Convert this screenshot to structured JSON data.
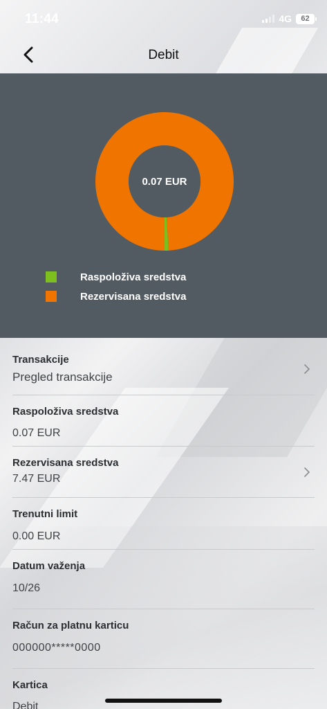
{
  "status_bar": {
    "time": "11:44",
    "network": "4G",
    "battery": "62"
  },
  "header": {
    "title": "Debit"
  },
  "chart_data": {
    "type": "pie",
    "center_label": "0.07 EUR",
    "slices": [
      {
        "name": "Raspoloživa sredstva",
        "value": 0.07,
        "color": "#7cbf1e"
      },
      {
        "name": "Rezervisana sredstva",
        "value": 7.47,
        "color": "#f07400"
      }
    ]
  },
  "legend": [
    {
      "label": "Raspoloživa sredstva",
      "color": "#7cbf1e"
    },
    {
      "label": "Rezervisana sredstva",
      "color": "#f07400"
    }
  ],
  "rows": [
    {
      "label": "Transakcije",
      "value": "Pregled transakcije"
    },
    {
      "label": "Raspoloživa sredstva",
      "value": "0.07 EUR"
    },
    {
      "label": "Rezervisana sredstva",
      "value": "7.47 EUR"
    },
    {
      "label": "Trenutni limit",
      "value": "0.00 EUR"
    },
    {
      "label": "Datum važenja",
      "value": "10/26"
    },
    {
      "label": "Račun za platnu karticu",
      "value": "000000*****0000"
    },
    {
      "label": "Kartica",
      "value": "Debit"
    }
  ],
  "icons": {
    "back": "chevron-left-icon",
    "row_arrow": "chevron-right-icon"
  },
  "colors": {
    "panel": "#525b61",
    "accent_orange": "#f07400",
    "accent_green": "#7cbf1e"
  }
}
